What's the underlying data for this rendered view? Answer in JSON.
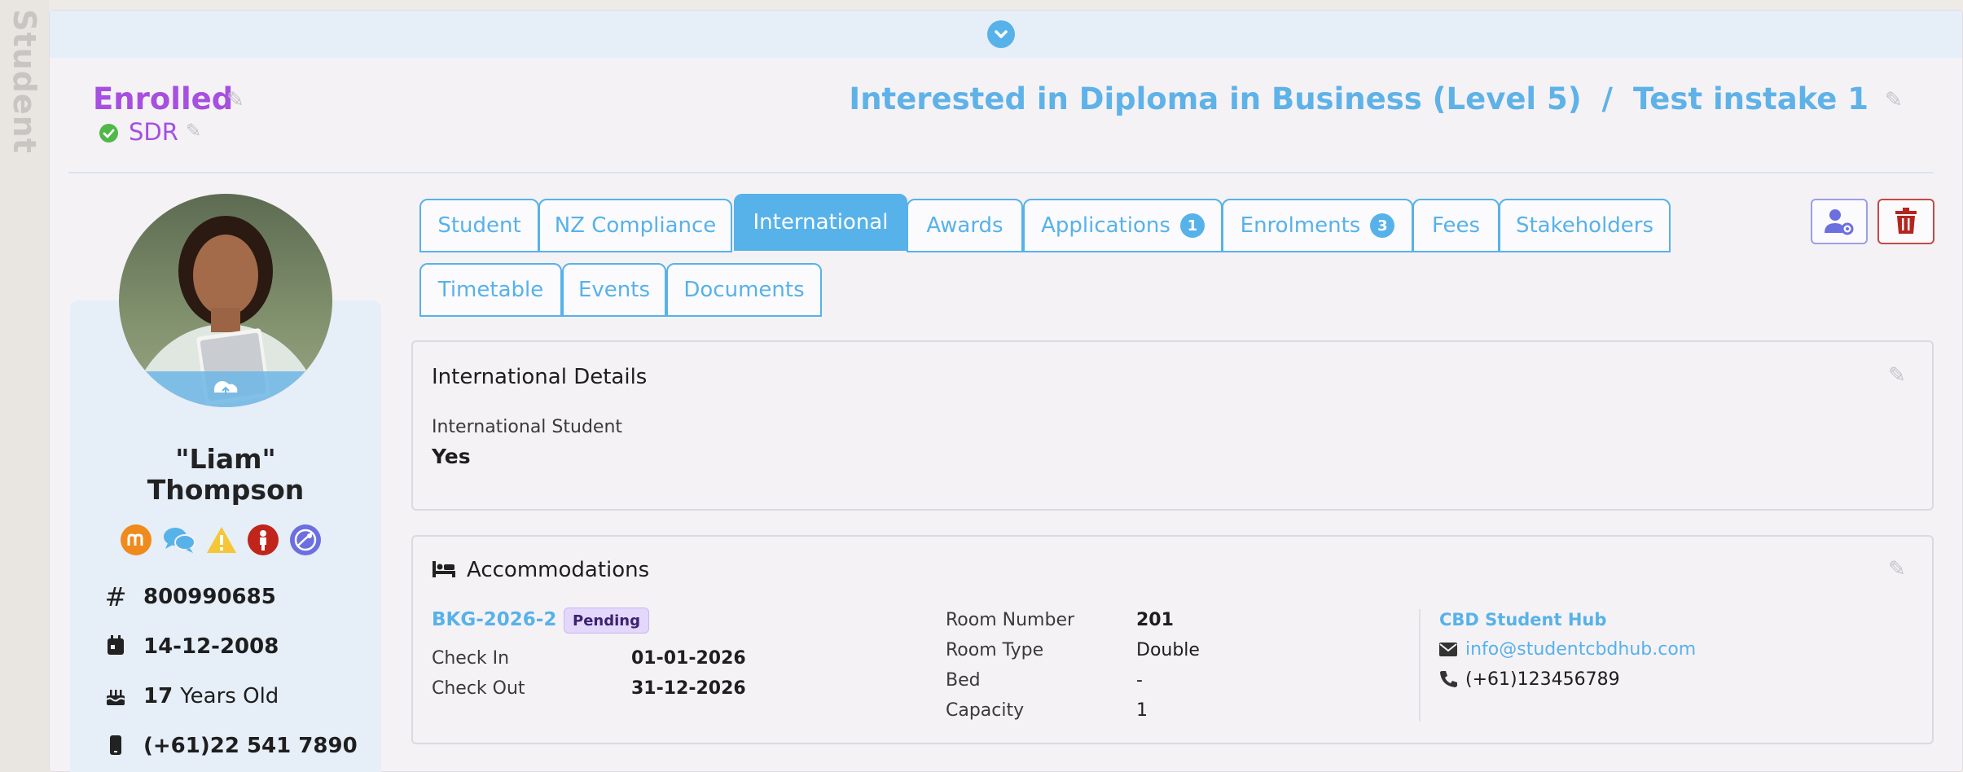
{
  "side_tab": {
    "label": "Student"
  },
  "header": {
    "status": "Enrolled",
    "sub_status": "SDR",
    "program": "Interested in Diploma in Business (Level 5)",
    "separator": "/",
    "intake": "Test instake 1"
  },
  "profile": {
    "nickname": "\"Liam\"",
    "surname": "Thompson",
    "icons": [
      "moodle-icon",
      "chat-icon",
      "warning-icon",
      "person-icon",
      "globe-icon"
    ],
    "id_number": "800990685",
    "dob": "14-12-2008",
    "age": "17",
    "age_suffix": "Years Old",
    "phone": "(+61)22 541 7890"
  },
  "tabs": [
    {
      "label": "Student",
      "active": false
    },
    {
      "label": "NZ Compliance",
      "active": false
    },
    {
      "label": "International",
      "active": true
    },
    {
      "label": "Awards",
      "active": false
    },
    {
      "label": "Applications",
      "badge": "1",
      "active": false
    },
    {
      "label": "Enrolments",
      "badge": "3",
      "active": false
    },
    {
      "label": "Fees",
      "active": false
    },
    {
      "label": "Stakeholders",
      "active": false
    },
    {
      "label": "Timetable",
      "active": false
    },
    {
      "label": "Events",
      "active": false
    },
    {
      "label": "Documents",
      "active": false
    }
  ],
  "international": {
    "title": "International Details",
    "field_label": "International Student",
    "field_value": "Yes"
  },
  "accommodations": {
    "title": "Accommodations",
    "booking_id": "BKG-2026-2",
    "booking_status": "Pending",
    "check_in_label": "Check In",
    "check_in": "01-01-2026",
    "check_out_label": "Check Out",
    "check_out": "31-12-2026",
    "room_number_label": "Room Number",
    "room_number": "201",
    "room_type_label": "Room Type",
    "room_type": "Double",
    "bed_label": "Bed",
    "bed": "-",
    "capacity_label": "Capacity",
    "capacity": "1",
    "provider": "CBD Student Hub",
    "email": "info@studentcbdhub.com",
    "phone": "(+61)123456789"
  },
  "colors": {
    "accent": "#57b2e9",
    "status": "#a64fe0",
    "danger": "#b3261e",
    "pending": "#e3d7fb"
  }
}
